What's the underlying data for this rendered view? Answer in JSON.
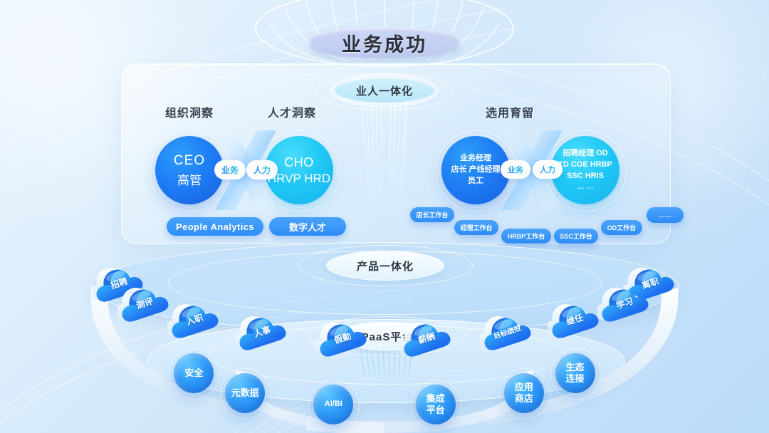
{
  "title": {
    "main": "业务成功"
  },
  "center_labels": {
    "integration": "业人一体化",
    "product": "产品一体化",
    "paas": "PaaS平台"
  },
  "insight_group": {
    "titles": {
      "left": "组织洞察",
      "right": "人才洞察"
    },
    "left_lobe": {
      "line1": "CEO",
      "line2": "高管"
    },
    "right_lobe": {
      "line1": "CHO",
      "line2": "HRVP HRD"
    },
    "connectors": {
      "business": "业务",
      "hr": "人力"
    },
    "badges": [
      {
        "label": "People Analytics"
      },
      {
        "label": "数字人才"
      }
    ]
  },
  "talent_group": {
    "title": "选用育留",
    "left_lobe": {
      "line1": "业务经理",
      "line2": "店长  产线经理",
      "line3": "员工"
    },
    "right_lobe": {
      "line1": "招聘经理  OD",
      "line2": "TD  COE  HRBP",
      "line3": "SSC  HRIS",
      "line4": "…  …"
    },
    "connectors": {
      "business": "业务",
      "hr": "人力"
    },
    "workbenches": [
      {
        "label": "店长工作台"
      },
      {
        "label": "经理工作台"
      },
      {
        "label": "HRBP工作台"
      },
      {
        "label": "SSC工作台"
      },
      {
        "label": "OD工作台"
      },
      {
        "label": "……"
      }
    ]
  },
  "product_clouds": [
    {
      "label": "招聘"
    },
    {
      "label": "测评"
    },
    {
      "label": "入职"
    },
    {
      "label": "人事"
    },
    {
      "label": "假勤"
    },
    {
      "label": "薪酬"
    },
    {
      "label": "目标绩效"
    },
    {
      "label": "继任"
    },
    {
      "label": "学习"
    },
    {
      "label": "离职"
    }
  ],
  "paas_spheres": [
    {
      "line1": "安全",
      "line2": ""
    },
    {
      "line1": "元数据",
      "line2": ""
    },
    {
      "line1": "AI/BI",
      "line2": ""
    },
    {
      "line1": "集成",
      "line2": "平台"
    },
    {
      "line1": "应用",
      "line2": "商店"
    },
    {
      "line1": "生态",
      "line2": "连接"
    }
  ],
  "colors": {
    "deep_blue": "#1a5fe0",
    "bright_blue": "#2f8df7",
    "cyan": "#1fc7f6",
    "banner": "#c2cdf1",
    "text_dark": "#2b2f3a"
  }
}
